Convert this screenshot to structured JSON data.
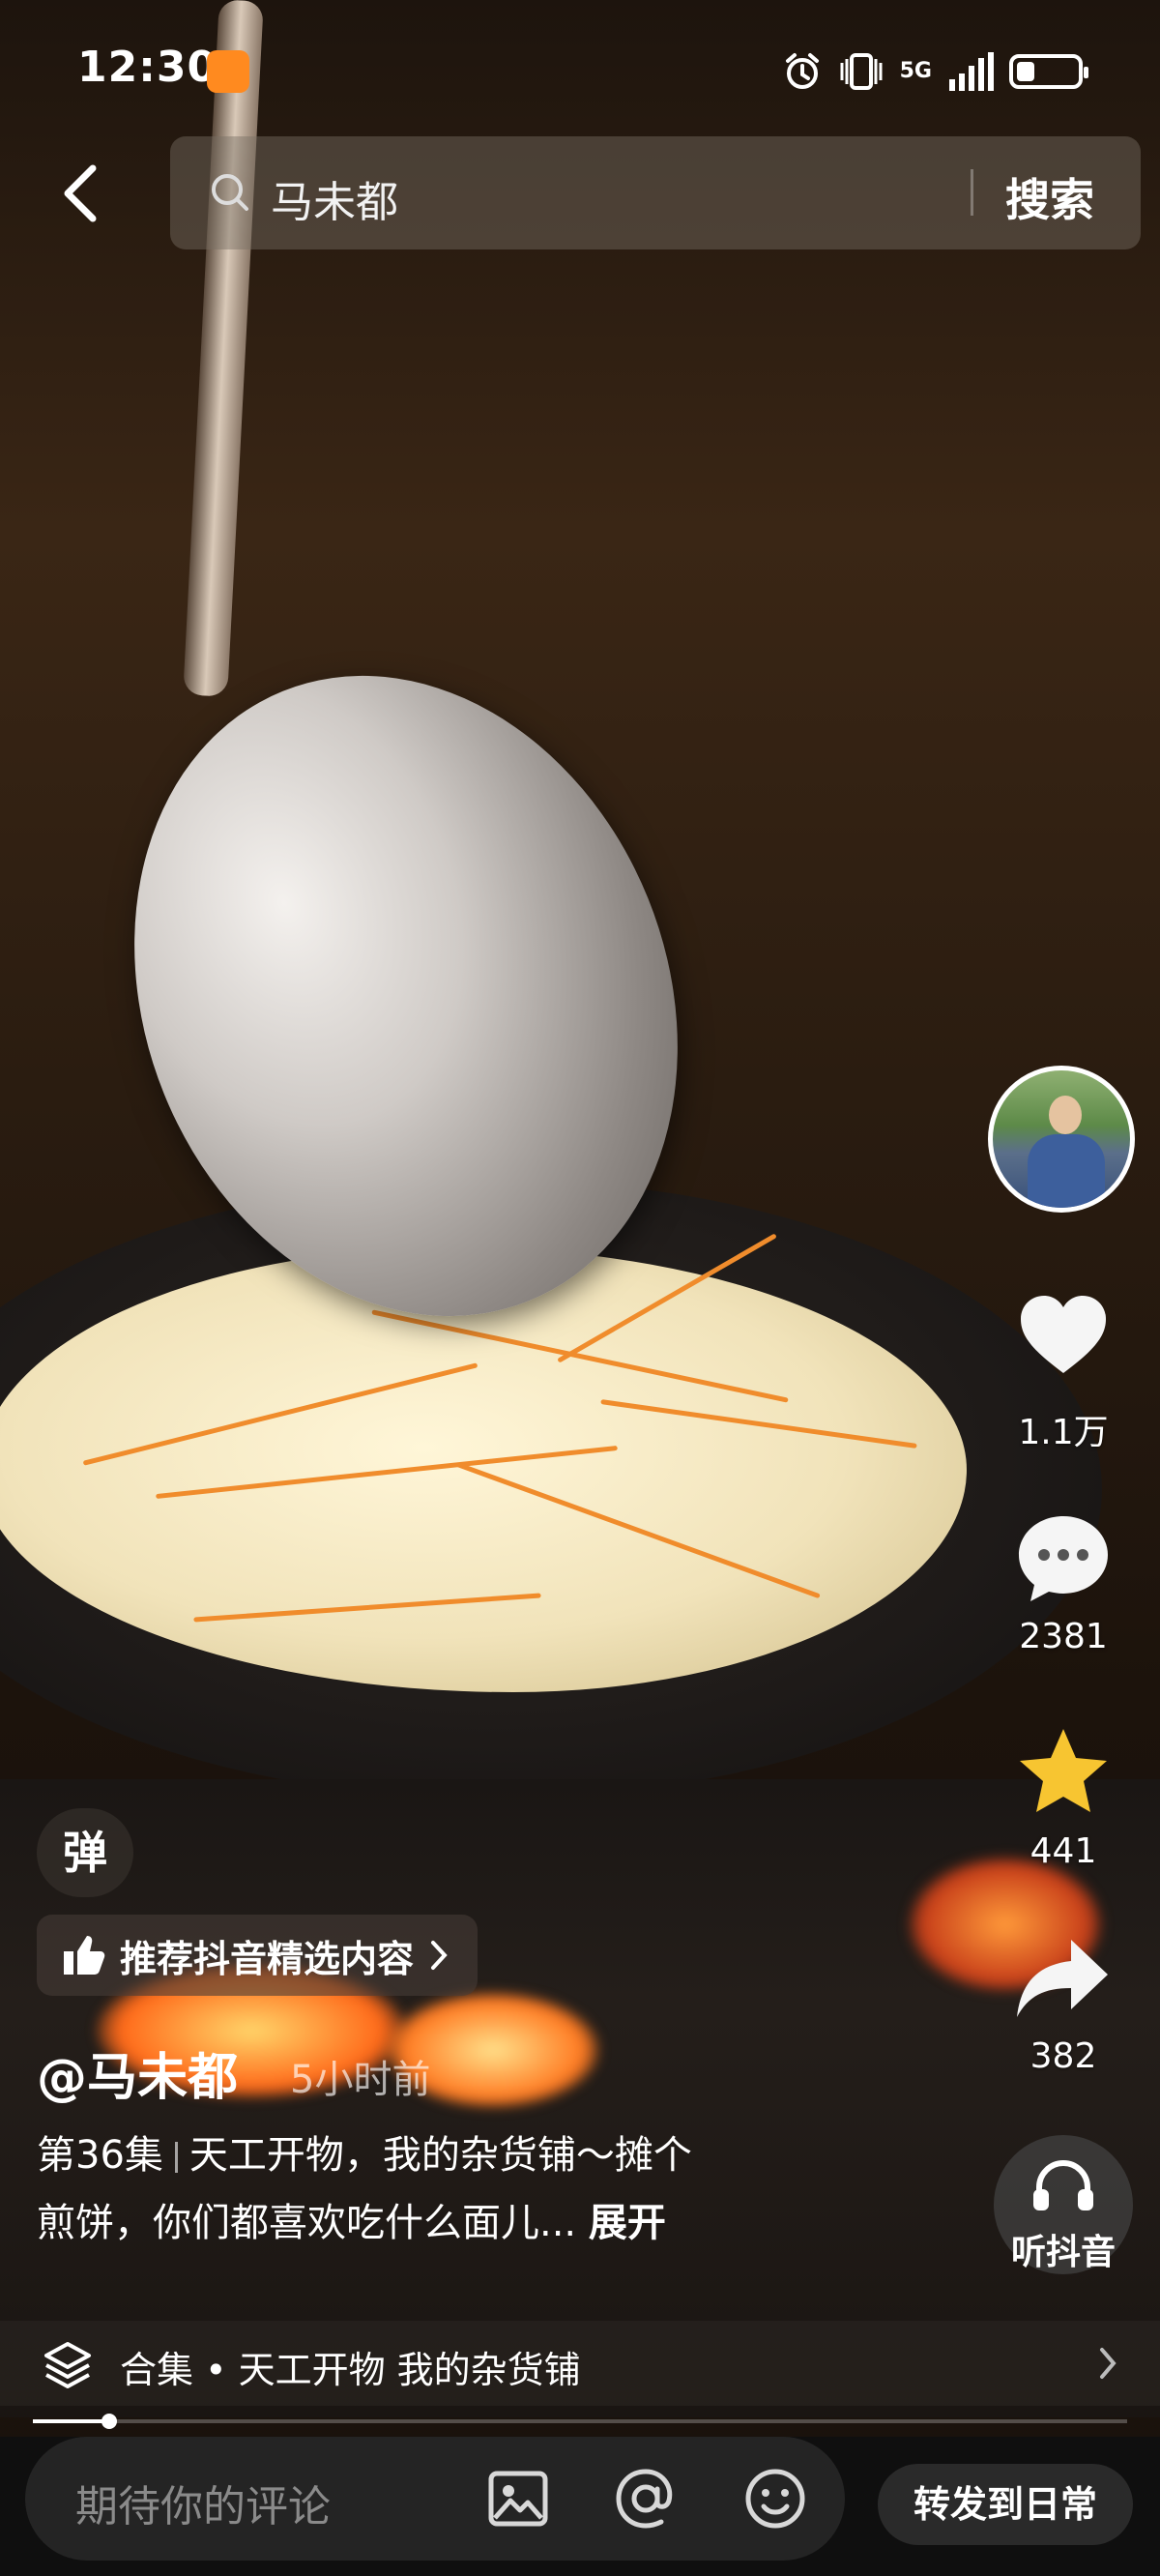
{
  "status_bar": {
    "time": "12:30",
    "network": "5G",
    "battery_percent": 30
  },
  "header": {
    "search_query": "马未都",
    "search_button": "搜索"
  },
  "video": {
    "playback_progress": 0.07
  },
  "rail": {
    "like_count": "1.1万",
    "comment_count": "2381",
    "favorite_count": "441",
    "share_count": "382",
    "listen_label": "听抖音"
  },
  "overlay": {
    "danmu_label": "弹",
    "recommend_label": "推荐抖音精选内容",
    "author": "@马未都",
    "time_ago": "5小时前",
    "episode": "第36集",
    "caption_line1": "天工开物，我的杂货铺～摊个",
    "caption_line2": "煎饼，你们都喜欢吃什么面儿...",
    "expand_label": "展开"
  },
  "collection": {
    "label": "合集 • 天工开物 我的杂货铺"
  },
  "bottom_bar": {
    "comment_placeholder": "期待你的评论",
    "share_button": "转发到日常"
  },
  "colors": {
    "accent_star": "#f7c531",
    "background": "#0f0f0f"
  }
}
